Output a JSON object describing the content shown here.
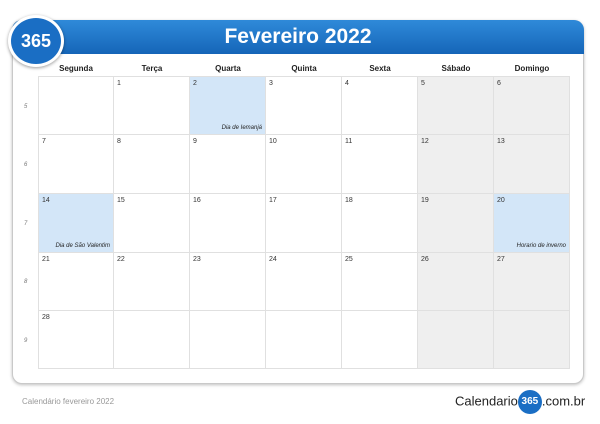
{
  "header": {
    "badge": "365",
    "title": "Fevereiro 2022"
  },
  "weekdays": [
    "Segunda",
    "Terça",
    "Quarta",
    "Quinta",
    "Sexta",
    "Sábado",
    "Domingo"
  ],
  "weeks": [
    "5",
    "6",
    "7",
    "8",
    "9"
  ],
  "days": {
    "w0": [
      "",
      "1",
      "2",
      "3",
      "4",
      "5",
      "6"
    ],
    "w1": [
      "7",
      "8",
      "9",
      "10",
      "11",
      "12",
      "13"
    ],
    "w2": [
      "14",
      "15",
      "16",
      "17",
      "18",
      "19",
      "20"
    ],
    "w3": [
      "21",
      "22",
      "23",
      "24",
      "25",
      "26",
      "27"
    ],
    "w4": [
      "28",
      "",
      "",
      "",
      "",
      "",
      ""
    ]
  },
  "notes": {
    "iemanja": "Dia de Iemanjá",
    "valentim": "Dia de São Valentim",
    "inverno": "Horario de inverno"
  },
  "footer": {
    "caption": "Calendário fevereiro 2022",
    "brand_left": "Calendario",
    "brand_badge": "365",
    "brand_right": ".com.br"
  }
}
